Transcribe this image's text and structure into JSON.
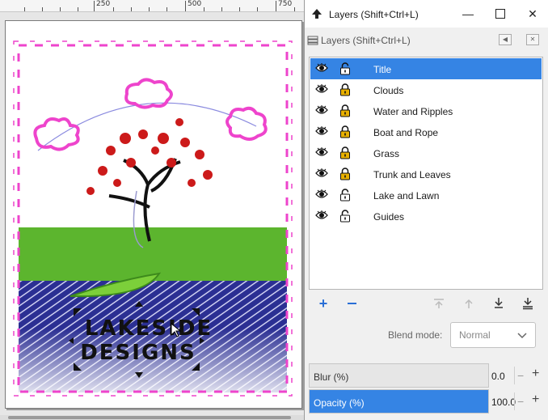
{
  "ruler": {
    "labels": [
      "250",
      "500",
      "750"
    ]
  },
  "dialog": {
    "title": "Layers (Shift+Ctrl+L)",
    "dock_title": "Layers (Shift+Ctrl+L)",
    "minimize_icon": "minimize-icon",
    "maximize_icon": "maximize-icon",
    "close_icon": "close-icon"
  },
  "layers": [
    {
      "name": "Title",
      "visible": true,
      "locked": false,
      "selected": true
    },
    {
      "name": "Clouds",
      "visible": true,
      "locked": true,
      "selected": false
    },
    {
      "name": "Water and Ripples",
      "visible": true,
      "locked": true,
      "selected": false
    },
    {
      "name": "Boat and Rope",
      "visible": true,
      "locked": true,
      "selected": false
    },
    {
      "name": "Grass",
      "visible": true,
      "locked": true,
      "selected": false
    },
    {
      "name": "Trunk and Leaves",
      "visible": true,
      "locked": true,
      "selected": false
    },
    {
      "name": "Lake and Lawn",
      "visible": true,
      "locked": false,
      "selected": false
    },
    {
      "name": "Guides",
      "visible": true,
      "locked": false,
      "selected": false
    }
  ],
  "toolbar": {
    "add_icon": "plus-icon",
    "remove_icon": "minus-icon",
    "raise_top_icon": "raise-to-top-icon",
    "raise_icon": "raise-icon",
    "lower_icon": "lower-icon",
    "lower_bottom_icon": "lower-to-bottom-icon"
  },
  "blend": {
    "label": "Blend mode:",
    "value": "Normal"
  },
  "blur": {
    "label": "Blur (%)",
    "value": "0.0",
    "fraction": 0.0
  },
  "opacity": {
    "label": "Opacity (%)",
    "value": "100.0",
    "fraction": 1.0
  },
  "artwork": {
    "title_line1": "LAKESIDE",
    "title_line2": "DESIGNS"
  },
  "colors": {
    "accent": "#3584e4",
    "lock_gold": "#e8b000",
    "grass": "#5cb52e",
    "water": "#2b2f93",
    "cloud": "#ee44cc",
    "leaves": "#cc1a1a"
  }
}
